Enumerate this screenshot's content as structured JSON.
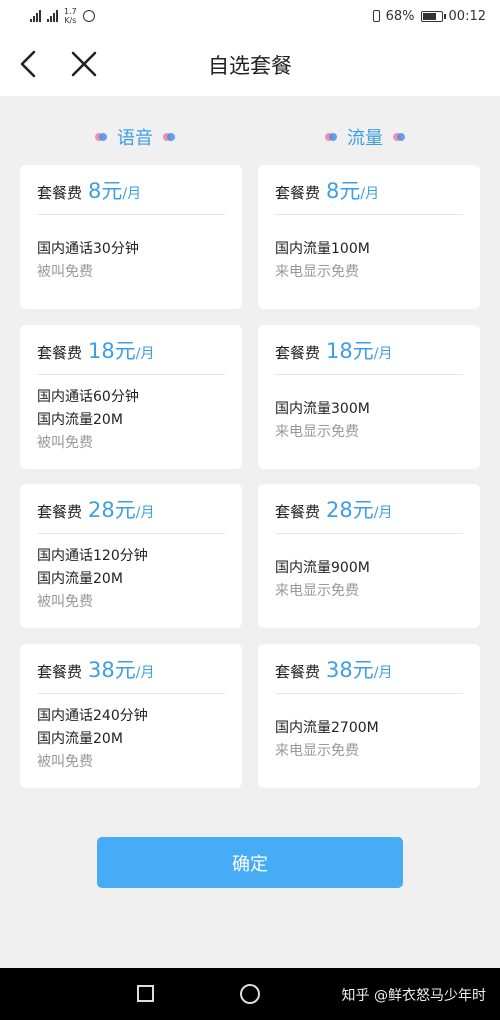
{
  "status": {
    "net_speed_value": "1.7",
    "net_speed_unit": "K/s",
    "battery": "68%",
    "time": "00:12",
    "icons": [
      "hd-icon",
      "signal-4g-icon",
      "signal-5g-icon",
      "alarm-icon",
      "vibrate-icon",
      "battery-icon"
    ]
  },
  "header": {
    "title": "自选套餐",
    "back_icon": "chevron-left-icon",
    "close_icon": "close-icon"
  },
  "columns": [
    {
      "name": "语音",
      "plans": [
        {
          "fee_label": "套餐费",
          "amount": "8元",
          "unit": "/月",
          "lines": [
            "国内通话30分钟"
          ],
          "note": "被叫免费"
        },
        {
          "fee_label": "套餐费",
          "amount": "18元",
          "unit": "/月",
          "lines": [
            "国内通话60分钟",
            "国内流量20M"
          ],
          "note": "被叫免费"
        },
        {
          "fee_label": "套餐费",
          "amount": "28元",
          "unit": "/月",
          "lines": [
            "国内通话120分钟",
            "国内流量20M"
          ],
          "note": "被叫免费"
        },
        {
          "fee_label": "套餐费",
          "amount": "38元",
          "unit": "/月",
          "lines": [
            "国内通话240分钟",
            "国内流量20M"
          ],
          "note": "被叫免费"
        }
      ]
    },
    {
      "name": "流量",
      "plans": [
        {
          "fee_label": "套餐费",
          "amount": "8元",
          "unit": "/月",
          "lines": [
            "国内流量100M"
          ],
          "note": "来电显示免费"
        },
        {
          "fee_label": "套餐费",
          "amount": "18元",
          "unit": "/月",
          "lines": [
            "国内流量300M"
          ],
          "note": "来电显示免费"
        },
        {
          "fee_label": "套餐费",
          "amount": "28元",
          "unit": "/月",
          "lines": [
            "国内流量900M"
          ],
          "note": "来电显示免费"
        },
        {
          "fee_label": "套餐费",
          "amount": "38元",
          "unit": "/月",
          "lines": [
            "国内流量2700M"
          ],
          "note": "来电显示免费"
        }
      ]
    }
  ],
  "confirm_label": "确定",
  "watermark": "知乎 @鲜衣怒马少年时",
  "colors": {
    "accent": "#3d9ee6",
    "button": "#45acf5",
    "background": "#f0f0f0"
  }
}
